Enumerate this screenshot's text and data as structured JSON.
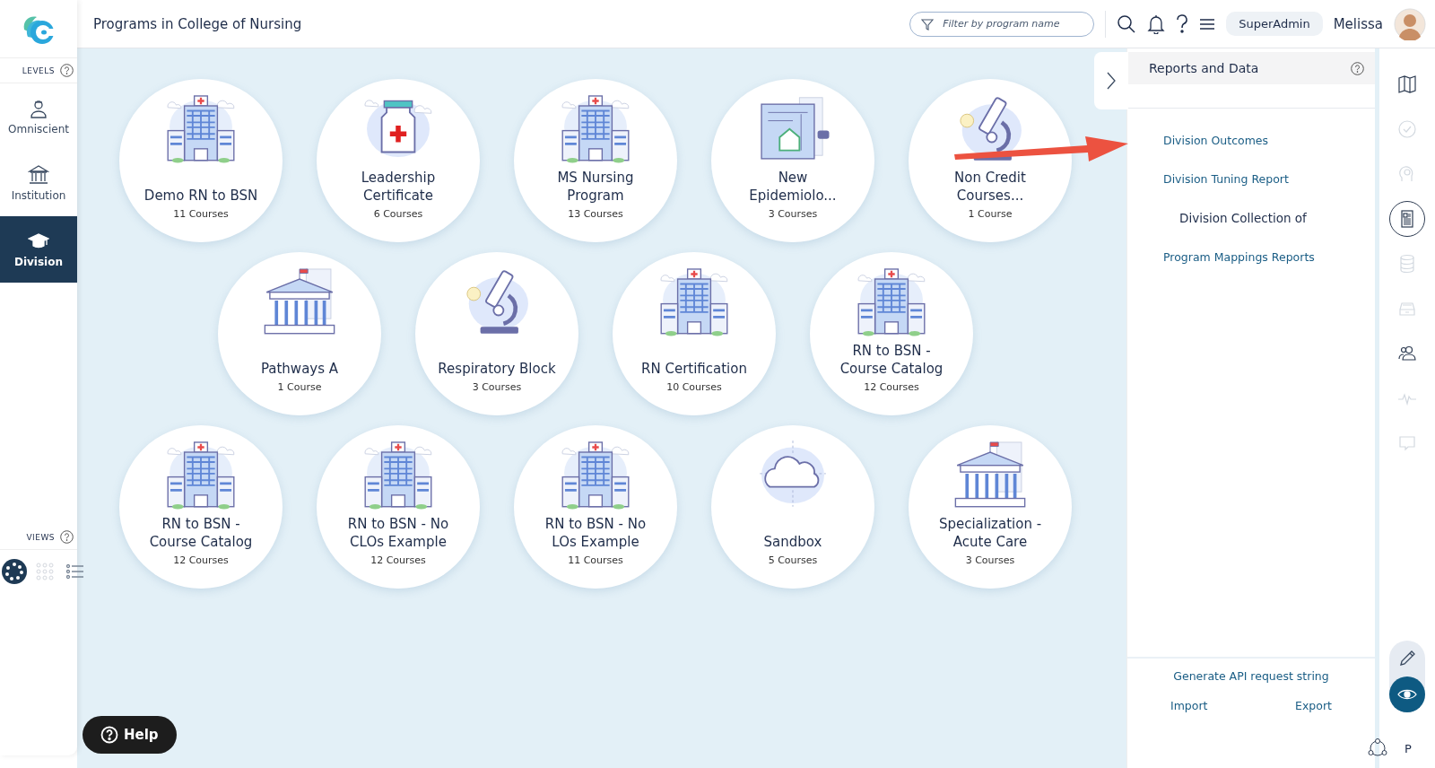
{
  "header": {
    "title": "Programs in College of Nursing",
    "filter_placeholder": "Filter by program name",
    "role": "SuperAdmin",
    "user": "Melissa"
  },
  "sidebar": {
    "levels_label": "LEVELS",
    "levels": [
      {
        "label": "Omniscient",
        "kind": "person",
        "selected": false
      },
      {
        "label": "Institution",
        "kind": "institution",
        "selected": false
      },
      {
        "label": "Division",
        "kind": "cap",
        "selected": true
      }
    ],
    "views_label": "VIEWS",
    "views": [
      {
        "kind": "ring",
        "selected": true
      },
      {
        "kind": "grid",
        "selected": false
      },
      {
        "kind": "list",
        "selected": false
      }
    ]
  },
  "programs": [
    [
      {
        "title_lines": [
          "Demo RN to BSN"
        ],
        "count": "11 Courses",
        "kind": "hospital"
      },
      {
        "title_lines": [
          "Leadership",
          "Certificate"
        ],
        "count": "6 Courses",
        "kind": "bottle"
      },
      {
        "title_lines": [
          "MS Nursing",
          "Program"
        ],
        "count": "13 Courses",
        "kind": "hospital"
      },
      {
        "title_lines": [
          "New",
          "Epidemiolo..."
        ],
        "count": "3 Courses",
        "kind": "blueprint"
      },
      {
        "title_lines": [
          "Non Credit",
          "Courses..."
        ],
        "count": "1 Course",
        "kind": "microscope"
      }
    ],
    [
      {
        "title_lines": [
          "Pathways A"
        ],
        "count": "1 Course",
        "kind": "courthouse"
      },
      {
        "title_lines": [
          "Respiratory Block"
        ],
        "count": "3 Courses",
        "kind": "microscope"
      },
      {
        "title_lines": [
          "RN Certification"
        ],
        "count": "10 Courses",
        "kind": "hospital"
      },
      {
        "title_lines": [
          "RN to BSN -",
          "Course Catalog"
        ],
        "count": "12 Courses",
        "kind": "hospital"
      }
    ],
    [
      {
        "title_lines": [
          "RN to BSN -",
          "Course Catalog"
        ],
        "count": "12 Courses",
        "kind": "hospital"
      },
      {
        "title_lines": [
          "RN to BSN - No",
          "CLOs Example"
        ],
        "count": "12 Courses",
        "kind": "hospital"
      },
      {
        "title_lines": [
          "RN to BSN - No",
          "LOs Example"
        ],
        "count": "11 Courses",
        "kind": "hospital"
      },
      {
        "title_lines": [
          "Sandbox"
        ],
        "count": "5 Courses",
        "kind": "cloud"
      },
      {
        "title_lines": [
          "Specialization -",
          "Acute Care"
        ],
        "count": "3 Courses",
        "kind": "courthouse"
      }
    ]
  ],
  "help_button": "Help",
  "panel": {
    "title": "Reports and Data",
    "items": [
      {
        "kind": "link",
        "text": "Division Outcomes"
      },
      {
        "kind": "link",
        "text": "Division Tuning Report"
      },
      {
        "kind": "heading",
        "text": "Division Collection of"
      },
      {
        "kind": "link",
        "text": "Program Mappings Reports"
      }
    ],
    "generate": "Generate API request string",
    "import": "Import",
    "export": "Export"
  },
  "rail": [
    {
      "kind": "map",
      "disabled": false,
      "selected": false
    },
    {
      "kind": "check",
      "disabled": true,
      "selected": false
    },
    {
      "kind": "brain",
      "disabled": true,
      "selected": false
    },
    {
      "kind": "report",
      "disabled": false,
      "selected": true
    },
    {
      "kind": "database",
      "disabled": true,
      "selected": false
    },
    {
      "kind": "inbox",
      "disabled": true,
      "selected": false
    },
    {
      "kind": "users",
      "disabled": false,
      "selected": false
    },
    {
      "kind": "pulse",
      "disabled": true,
      "selected": false
    },
    {
      "kind": "chat",
      "disabled": true,
      "selected": false
    }
  ],
  "modes": [
    {
      "kind": "pencil",
      "selected": false
    },
    {
      "kind": "eye",
      "selected": true
    }
  ],
  "footer_letter": "P"
}
